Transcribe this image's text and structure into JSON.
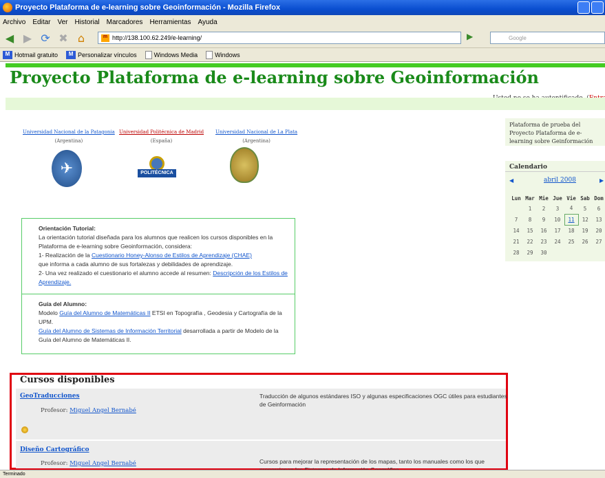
{
  "window": {
    "title": "Proyecto Plataforma de e-learning sobre Geoinformación - Mozilla Firefox"
  },
  "menu": [
    "Archivo",
    "Editar",
    "Ver",
    "Historial",
    "Marcadores",
    "Herramientas",
    "Ayuda"
  ],
  "nav": {
    "url": "http://138.100.62.249/e-learning/",
    "search_placeholder": "Google"
  },
  "bookmarks": [
    "Hotmail gratuito",
    "Personalizar vínculos",
    "Windows Media",
    "Windows"
  ],
  "page": {
    "title": "Proyecto Plataforma de e-learning sobre Geoinformación",
    "login_text": "Usted no se ha autentificado. (",
    "login_link": "Entrar"
  },
  "universities": [
    {
      "name": "Universidad Nacional de la Patagonia",
      "country": "(Argentina)"
    },
    {
      "name": "Universidad Politécnica de Madrid",
      "country": "(España)"
    },
    {
      "name": "Universidad Nacional de La Plata",
      "country": "(Argentina)"
    }
  ],
  "logo2_text": "POLITÉCNICA",
  "orientation": {
    "heading": "Orientación Tutorial:",
    "line1": "La orientación tutorial diseñada para los alumnos que realicen los cursos disponibles en la Plataforma de e-learning sobre Geoinformación, considera:",
    "item1_prefix": "1- Realización de la ",
    "item1_link": "Cuestionario Honey-Alonso de Estilos de Aprendizaje (CHAE)",
    "item1_suffix": "que informa a cada alumno de sus fortalezas y debilidades de aprendizaje.",
    "item2_prefix": "2- Una vez realizado el cuestionario el alumno accede al resumen: ",
    "item2_link": "Descripción de los Estilos de Aprendizaje."
  },
  "guide": {
    "heading": "Guía del Alumno:",
    "prefix": "Modelo ",
    "link1": "Guía del Alumno de Matemáticas II",
    "text1": " ETSI en Topografía , Geodesia y Cartografía de la UPM.",
    "link2": "Guía del Alumno de Sistemas de Información Territorial",
    "text2": " desarrollada a partir de Modelo de la Guía del Alumno de Matemáticas II."
  },
  "sidebar": {
    "description": "Plataforma de prueba del Proyecto Plataforma de e-learning sobre Geinformación",
    "calendar_title": "Calendario",
    "month": "abril 2008",
    "days": [
      "Lun",
      "Mar",
      "Mie",
      "Jue",
      "Vie",
      "Sab",
      "Dom"
    ],
    "weeks": [
      [
        "",
        "1",
        "2",
        "3",
        "4",
        "5",
        "6"
      ],
      [
        "7",
        "8",
        "9",
        "10",
        "11",
        "12",
        "13"
      ],
      [
        "14",
        "15",
        "16",
        "17",
        "18",
        "19",
        "20"
      ],
      [
        "21",
        "22",
        "23",
        "24",
        "25",
        "26",
        "27"
      ],
      [
        "28",
        "29",
        "30",
        "",
        "",
        "",
        ""
      ]
    ],
    "today": "11"
  },
  "courses": {
    "title": "Cursos disponibles",
    "items": [
      {
        "name": "GeoTraducciones",
        "prof_label": "Profesor: ",
        "prof": "Miguel Angel Bernabé",
        "desc": "Traducción de algunos estándares ISO y algunas especificaciones OGC útiles para estudiantes de Geinformación"
      },
      {
        "name": "Diseño Cartográfico",
        "prof_label": "Profesor: ",
        "prof": "Miguel Angel Bernabé",
        "desc": "Cursos para mejorar la representación de los mapas, tanto los manuales como los que proporcionan los Sistemas de Información Geográfica."
      }
    ]
  },
  "status": "Terminado"
}
